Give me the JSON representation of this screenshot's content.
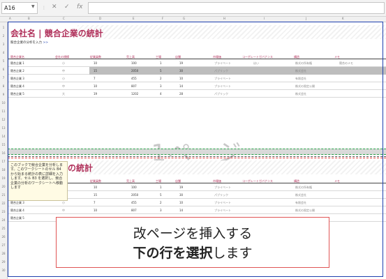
{
  "formula_bar": {
    "name_box": "A16",
    "icons": [
      "menu-dots-icon",
      "cancel-icon",
      "confirm-icon",
      "fx-icon"
    ],
    "cancel_glyph": "✕",
    "confirm_glyph": "✓",
    "fx_glyph": "fx",
    "formula_value": ""
  },
  "column_headers": [
    "A",
    "B",
    "C",
    "D",
    "E",
    "F",
    "G",
    "H",
    "I",
    "J",
    "K"
  ],
  "row_numbers": [
    "1",
    "2",
    "3",
    "4",
    "5",
    "6",
    "7",
    "8",
    "9",
    "10",
    "11",
    "12",
    "13",
    "14",
    "15",
    "16",
    "17",
    "18",
    "19",
    "20",
    "21",
    "22",
    "23",
    "24",
    "25",
    "26",
    "27",
    "28",
    "29",
    "30"
  ],
  "sheet": {
    "title": "会社名 | 競合企業の統計",
    "subnav": "競合企業の分析を入力",
    "subnav_link": ">>",
    "table_headers": [
      "競合企業名",
      "会社の規模",
      "従業員数",
      "売上高",
      "工場",
      "店舗",
      "市場価",
      "コーポレートガバナンス",
      "構造",
      "メモ"
    ],
    "rows": [
      [
        "競合企業 1",
        "小",
        "10",
        "100",
        "1",
        "19",
        "プライベート",
        "はい",
        "株式の所有権",
        "競合のメモ"
      ],
      [
        "競合企業 2",
        "中",
        "15",
        "2050",
        "5",
        "30",
        "パブリック",
        "",
        "株式会社",
        ""
      ],
      [
        "競合企業 3",
        "小",
        "7",
        "455",
        "2",
        "10",
        "プライベート",
        "",
        "有限会社",
        ""
      ],
      [
        "競合企業 4",
        "中",
        "10",
        "807",
        "3",
        "14",
        "プライベート",
        "",
        "株式の限定公開",
        ""
      ],
      [
        "競合企業 5",
        "大",
        "19",
        "1202",
        "4",
        "28",
        "パブリック",
        "",
        "株式会社",
        ""
      ]
    ],
    "page_watermark": "1ページ",
    "title_fragment": "の統計",
    "page2_rows": [
      [
        "",
        "",
        "10",
        "100",
        "1",
        "19",
        "プライベート",
        "",
        "株式の所有権",
        ""
      ],
      [
        "",
        "",
        "15",
        "2050",
        "5",
        "30",
        "パブリック",
        "",
        "株式会社",
        ""
      ],
      [
        "競合企業 3",
        "小",
        "7",
        "455",
        "2",
        "10",
        "プライベート",
        "",
        "有限会社",
        ""
      ],
      [
        "競合企業 4",
        "中",
        "10",
        "807",
        "3",
        "14",
        "プライベート",
        "",
        "株式の限定公開",
        ""
      ],
      [
        "競合企業 5",
        "",
        "",
        "",
        "",
        "",
        "",
        "",
        "",
        ""
      ]
    ]
  },
  "comment": "このブックで競合企業を分析します。このワークシートのセル B4 から始まる統計の表に詳細を入力します。セル B3 を選択し、競合企業の分析のワークシートへ移動します",
  "callout": {
    "line1": "改ページを挿入する",
    "line2_bold": "下の行を選択",
    "line2_rest": "します"
  }
}
